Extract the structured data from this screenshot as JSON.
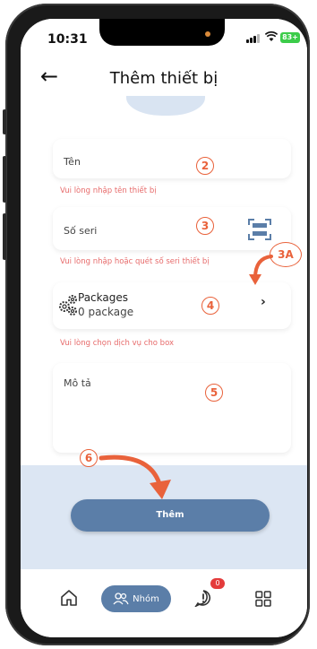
{
  "status_bar": {
    "time": "10:31",
    "battery": "83+"
  },
  "header": {
    "title": "Thêm thiết bị",
    "back_icon": "arrow-left-icon"
  },
  "form": {
    "name": {
      "placeholder": "Tên",
      "error": "Vui lòng nhập tên thiết bị"
    },
    "serial": {
      "placeholder": "Số seri",
      "error": "Vui lòng nhập hoặc quét số seri thiết bị",
      "scan_icon": "qr-scan-icon"
    },
    "packages": {
      "title": "Packages",
      "count": "0 package",
      "error": "Vui lòng chọn dịch vụ cho box",
      "icon": "gears-icon"
    },
    "description": {
      "placeholder": "Mô tả"
    }
  },
  "annotations": {
    "n2": "2",
    "n3": "3",
    "n3a": "3A",
    "n4": "4",
    "n5": "5",
    "n6": "6"
  },
  "submit_label": "Thêm",
  "bottom_nav": {
    "home_icon": "home-icon",
    "group_label": "Nhóm",
    "alert_badge": "0",
    "alert_icon": "alert-icon",
    "grid_icon": "grid-icon"
  },
  "colors": {
    "accent": "#5b7ea8",
    "error": "#e76b6b",
    "annotation": "#e9623b",
    "panel": "#dce6f3"
  }
}
